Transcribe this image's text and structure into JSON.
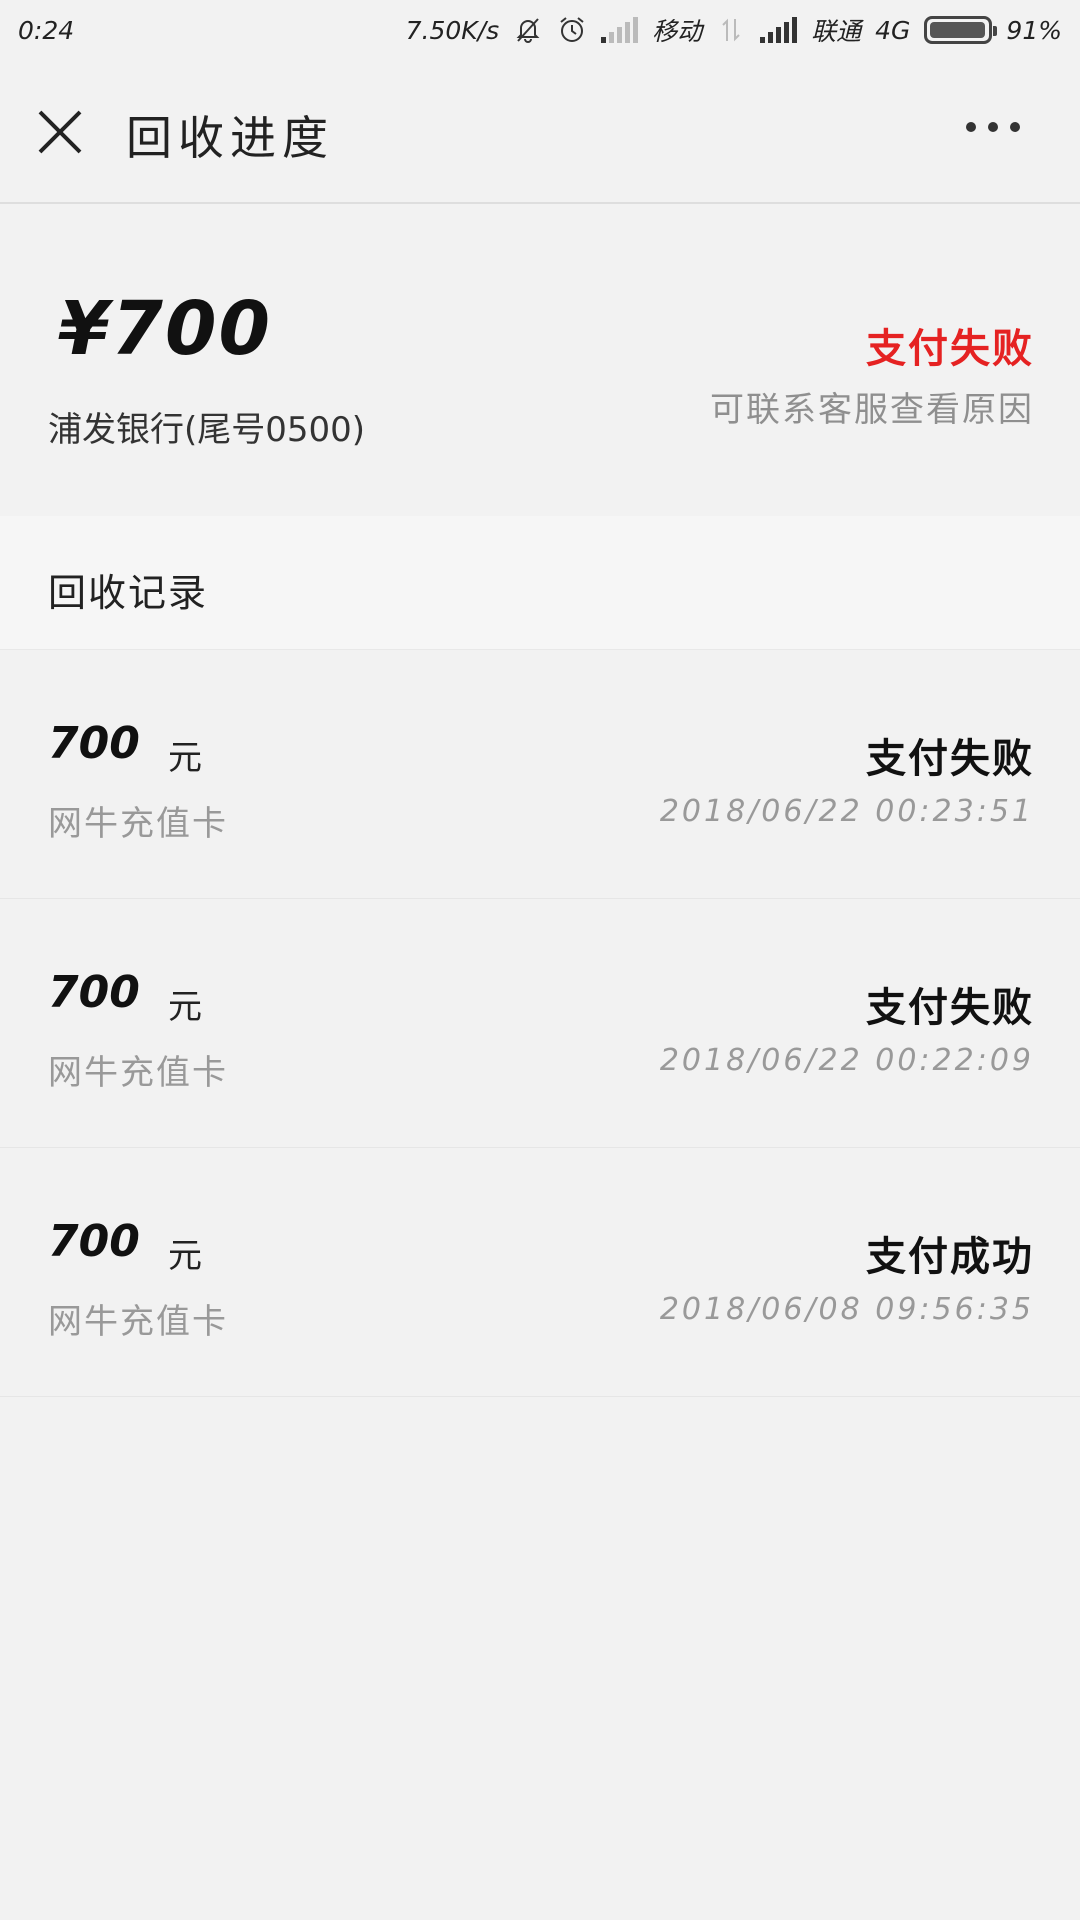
{
  "status_bar": {
    "time": "0:24",
    "net_speed": "7.50K/s",
    "carrier1": "移动",
    "carrier2": "联通",
    "network": "4G",
    "battery": "91%",
    "battery_level": 0.91,
    "icons": [
      "mute-bell-icon",
      "alarm-icon",
      "signal-icon",
      "data-transfer-icon",
      "battery-icon"
    ]
  },
  "header": {
    "title": "回收进度",
    "close_icon": "close-icon",
    "more_icon": "more-icon"
  },
  "summary": {
    "amount": "¥700",
    "bank": "浦发银行(尾号0500)",
    "status": "支付失败",
    "status_color": "#e52222",
    "hint": "可联系客服查看原因"
  },
  "records": {
    "title": "回收记录",
    "items": [
      {
        "amount": "700",
        "unit": "元",
        "type": "网牛充值卡",
        "status": "支付失败",
        "time": "2018/06/22 00:23:51"
      },
      {
        "amount": "700",
        "unit": "元",
        "type": "网牛充值卡",
        "status": "支付失败",
        "time": "2018/06/22 00:22:09"
      },
      {
        "amount": "700",
        "unit": "元",
        "type": "网牛充值卡",
        "status": "支付成功",
        "time": "2018/06/08 09:56:35"
      }
    ]
  }
}
